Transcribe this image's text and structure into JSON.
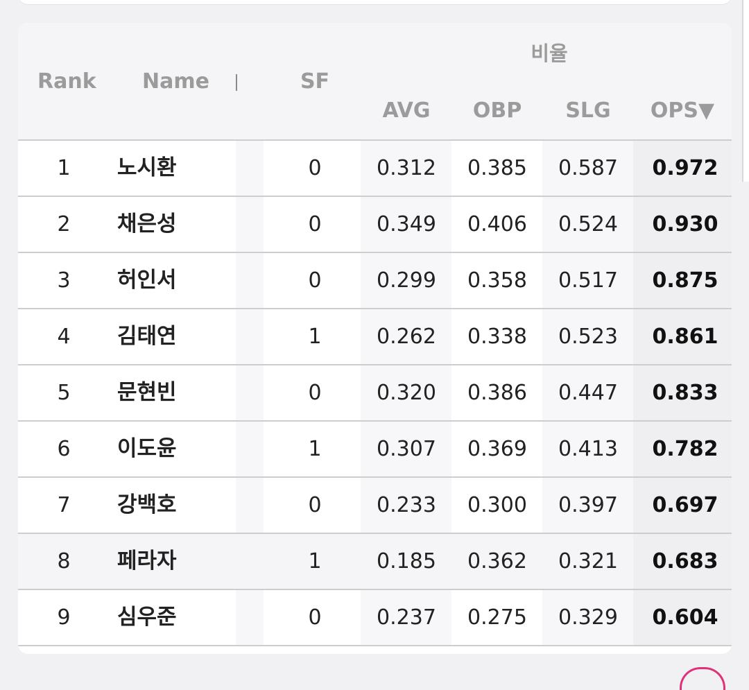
{
  "table": {
    "group_header": "비율",
    "headers": {
      "rank": "Rank",
      "name": "Name",
      "sf": "SF",
      "avg": "AVG",
      "obp": "OBP",
      "slg": "SLG",
      "ops": "OPS▼"
    },
    "rows": [
      {
        "rank": "1",
        "name": "노시환",
        "sf": "0",
        "avg": "0.312",
        "obp": "0.385",
        "slg": "0.587",
        "ops": "0.972"
      },
      {
        "rank": "2",
        "name": "채은성",
        "sf": "0",
        "avg": "0.349",
        "obp": "0.406",
        "slg": "0.524",
        "ops": "0.930"
      },
      {
        "rank": "3",
        "name": "허인서",
        "sf": "0",
        "avg": "0.299",
        "obp": "0.358",
        "slg": "0.517",
        "ops": "0.875"
      },
      {
        "rank": "4",
        "name": "김태연",
        "sf": "1",
        "avg": "0.262",
        "obp": "0.338",
        "slg": "0.523",
        "ops": "0.861"
      },
      {
        "rank": "5",
        "name": "문현빈",
        "sf": "0",
        "avg": "0.320",
        "obp": "0.386",
        "slg": "0.447",
        "ops": "0.833"
      },
      {
        "rank": "6",
        "name": "이도윤",
        "sf": "1",
        "avg": "0.307",
        "obp": "0.369",
        "slg": "0.413",
        "ops": "0.782"
      },
      {
        "rank": "7",
        "name": "강백호",
        "sf": "0",
        "avg": "0.233",
        "obp": "0.300",
        "slg": "0.397",
        "ops": "0.697"
      },
      {
        "rank": "8",
        "name": "페라자",
        "sf": "1",
        "avg": "0.185",
        "obp": "0.362",
        "slg": "0.321",
        "ops": "0.683"
      },
      {
        "rank": "9",
        "name": "심우준",
        "sf": "0",
        "avg": "0.237",
        "obp": "0.275",
        "slg": "0.329",
        "ops": "0.604"
      }
    ]
  }
}
